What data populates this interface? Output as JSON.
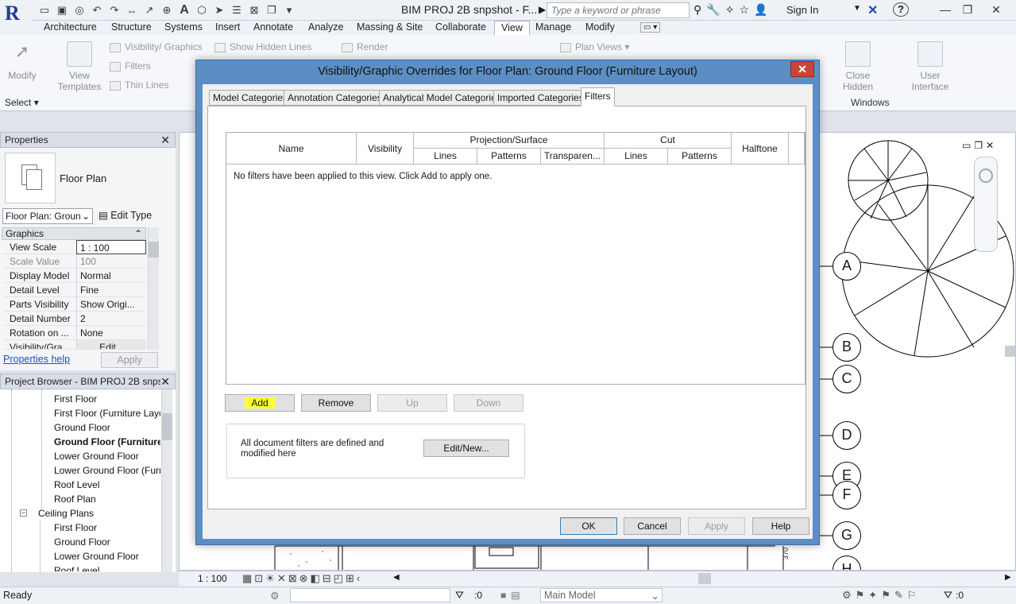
{
  "app": {
    "title": "BIM PROJ 2B snpshot - F...",
    "search_placeholder": "Type a keyword or phrase",
    "sign_in": "Sign In",
    "help": "?"
  },
  "ribbon_tabs": [
    "Architecture",
    "Structure",
    "Systems",
    "Insert",
    "Annotate",
    "Analyze",
    "Massing & Site",
    "Collaborate",
    "View",
    "Manage",
    "Modify"
  ],
  "ribbon": {
    "modify": "Modify",
    "view_templates": "View Templates",
    "visibility_graphics": "Visibility/ Graphics",
    "filters": "Filters",
    "thin_lines": "Thin Lines",
    "show_hidden_lines": "Show Hidden Lines",
    "render": "Render",
    "plan_views": "Plan Views",
    "close_hidden": "Close Hidden",
    "user_interface": "User Interface",
    "windows_group": "Windows",
    "select": "Select"
  },
  "properties": {
    "header": "Properties",
    "type_name": "Floor Plan",
    "instance_selector": "Floor Plan: Groun",
    "edit_type": "Edit Type",
    "group": "Graphics",
    "rows": [
      {
        "k": "View Scale",
        "v": "1 : 100"
      },
      {
        "k": "Scale Value",
        "v": "100"
      },
      {
        "k": "Display Model",
        "v": "Normal"
      },
      {
        "k": "Detail Level",
        "v": "Fine"
      },
      {
        "k": "Parts Visibility",
        "v": "Show Origi..."
      },
      {
        "k": "Detail Number",
        "v": "2"
      },
      {
        "k": "Rotation on ...",
        "v": "None"
      },
      {
        "k": "Visibility/Gra...",
        "v": "Edit..."
      }
    ],
    "help_link": "Properties help",
    "apply": "Apply"
  },
  "browser": {
    "header": "Project Browser - BIM PROJ 2B snps...",
    "items": [
      "First Floor",
      "First Floor (Furniture Layo",
      "Ground  Floor",
      "Ground  Floor  (Furniture",
      "Lower Ground Floor",
      "Lower Ground Floor (Furn",
      "Roof Level",
      "Roof Plan",
      "Ceiling Plans",
      "First Floor",
      "Ground  Floor",
      "Lower Ground Floor",
      "Roof Level"
    ]
  },
  "grid_labels": [
    "A",
    "B",
    "C",
    "D",
    "E",
    "F",
    "G",
    "H"
  ],
  "dimension_text": "370",
  "view_bar": {
    "scale": "1 : 100"
  },
  "status": {
    "ready": "Ready",
    "sel_count": ":0",
    "model": "Main Model",
    "filter_count": ":0"
  },
  "dialog": {
    "title": "Visibility/Graphic Overrides for Floor Plan: Ground  Floor  (Furniture  Layout)",
    "tabs": [
      "Model Categories",
      "Annotation Categories",
      "Analytical Model Categories",
      "Imported Categories",
      "Filters"
    ],
    "columns": {
      "name": "Name",
      "visibility": "Visibility",
      "projection": "Projection/Surface",
      "proj_lines": "Lines",
      "proj_patterns": "Patterns",
      "proj_transparency": "Transparen...",
      "cut": "Cut",
      "cut_lines": "Lines",
      "cut_patterns": "Patterns",
      "halftone": "Halftone"
    },
    "empty_message": "No filters have been applied to this view. Click Add to apply one.",
    "buttons": {
      "add": "Add",
      "remove": "Remove",
      "up": "Up",
      "down": "Down",
      "edit_new": "Edit/New..."
    },
    "note": "All document filters are defined and modified here",
    "footer": {
      "ok": "OK",
      "cancel": "Cancel",
      "apply": "Apply",
      "help": "Help"
    }
  },
  "colors": {
    "dialog_frame": "#5b8ec4",
    "highlight": "#ffff33",
    "close_button": "#c9453b"
  }
}
